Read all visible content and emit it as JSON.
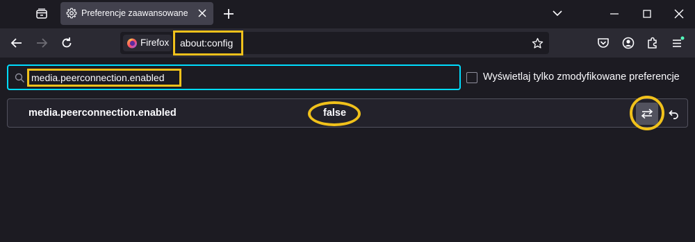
{
  "browser": {
    "tab": {
      "title": "Preferencje zaawansowane",
      "icon": "gear-icon"
    },
    "identity_label": "Firefox",
    "url": "about:config"
  },
  "config": {
    "search": {
      "value": "media.peerconnection.enabled"
    },
    "show_modified_only_label": "Wyświetlaj tylko zmodyfikowane preferencje",
    "show_modified_only_checked": false,
    "preference": {
      "name": "media.peerconnection.enabled",
      "value": "false"
    }
  },
  "colors": {
    "annotation_highlight": "#f0c11b",
    "search_focus": "#00ddff",
    "background": "#1c1b22",
    "toolbar": "#2b2a33"
  }
}
